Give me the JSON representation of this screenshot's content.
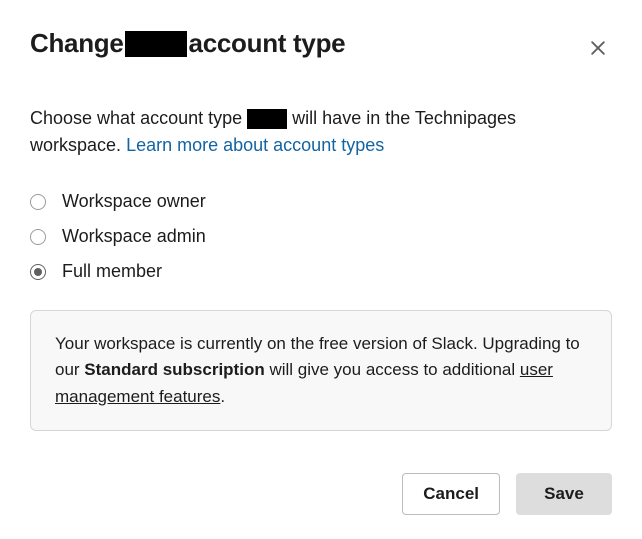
{
  "dialog": {
    "title_prefix": "Change",
    "title_suffix": "account type",
    "description_prefix": "Choose what account type",
    "description_suffix": "will have in the Technipages workspace.",
    "learn_more": "Learn more about account types"
  },
  "options": [
    {
      "label": "Workspace owner",
      "selected": false
    },
    {
      "label": "Workspace admin",
      "selected": false
    },
    {
      "label": "Full member",
      "selected": true
    }
  ],
  "info": {
    "text1": "Your workspace is currently on the free version of Slack. Upgrading to our ",
    "bold": "Standard subscription",
    "text2": " will give you access to additional ",
    "link": "user management features",
    "text3": "."
  },
  "buttons": {
    "cancel": "Cancel",
    "save": "Save"
  }
}
